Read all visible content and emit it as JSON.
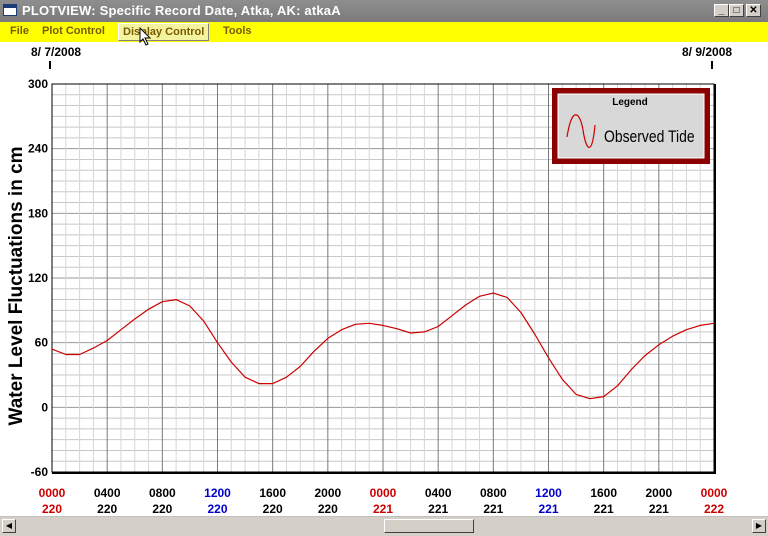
{
  "window": {
    "title": "PLOTVIEW: Specific Record Date, Atka, AK: atkaA",
    "min_glyph": "_",
    "max_glyph": "□",
    "close_glyph": "✕"
  },
  "menu": {
    "file": "File",
    "plot_control": "Plot Control",
    "display_control": "Display Control",
    "tools": "Tools"
  },
  "dates": {
    "start": "8/ 7/2008",
    "end": "8/ 9/2008"
  },
  "legend": {
    "title": "Legend",
    "entry": "Observed Tide"
  },
  "colors": {
    "series": "#cc0000",
    "legend_border": "#8b0000",
    "label_red": "#cc0000",
    "label_blue": "#0000cc",
    "label_black": "#000000"
  },
  "chart_data": {
    "type": "line",
    "ylabel": "Water Level Fluctuations in cm",
    "ylim": [
      -60,
      300
    ],
    "yticks": [
      300,
      240,
      180,
      120,
      60,
      0,
      -60
    ],
    "x_time_labels": [
      "0000",
      "0400",
      "0800",
      "1200",
      "1600",
      "2000",
      "0000",
      "0400",
      "0800",
      "1200",
      "1600",
      "2000",
      "0000"
    ],
    "x_day_labels": [
      "220",
      "220",
      "220",
      "220",
      "220",
      "220",
      "221",
      "221",
      "221",
      "221",
      "221",
      "221",
      "222"
    ],
    "x_label_colors": [
      "red",
      "black",
      "black",
      "blue",
      "black",
      "black",
      "red",
      "black",
      "black",
      "blue",
      "black",
      "black",
      "red"
    ],
    "xlim_hours": [
      0,
      48
    ],
    "grid": true,
    "legend_position": "top-right",
    "series": [
      {
        "name": "Observed Tide",
        "x_hours": [
          0,
          1,
          2,
          3,
          4,
          5,
          6,
          7,
          8,
          9,
          10,
          11,
          12,
          13,
          14,
          15,
          16,
          17,
          18,
          19,
          20,
          21,
          22,
          23,
          24,
          25,
          26,
          27,
          28,
          29,
          30,
          31,
          32,
          33,
          34,
          35,
          36,
          37,
          38,
          39,
          40,
          41,
          42,
          43,
          44,
          45,
          46,
          47,
          48
        ],
        "y": [
          54,
          49,
          49,
          55,
          62,
          72,
          82,
          91,
          98,
          100,
          94,
          80,
          60,
          42,
          28,
          22,
          22,
          28,
          38,
          52,
          64,
          72,
          77,
          78,
          76,
          73,
          69,
          70,
          75,
          85,
          95,
          103,
          106,
          102,
          88,
          68,
          46,
          26,
          12,
          8,
          10,
          20,
          35,
          48,
          58,
          66,
          72,
          76,
          78
        ]
      }
    ]
  }
}
